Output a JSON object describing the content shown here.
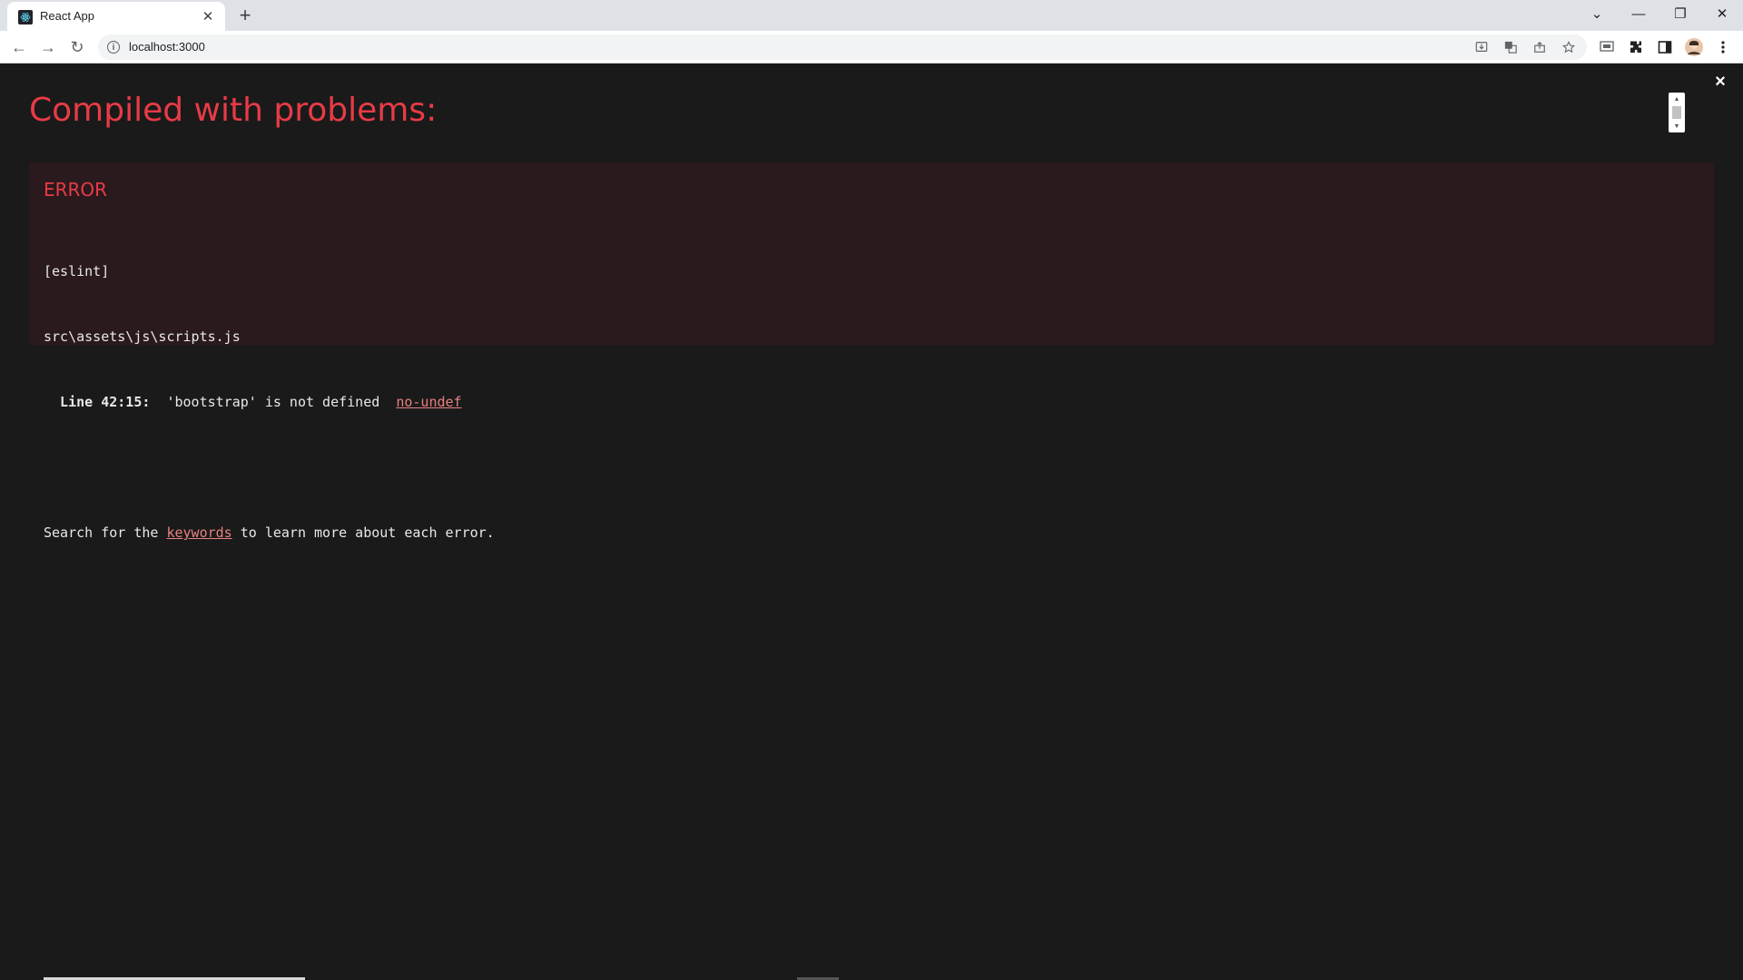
{
  "browser": {
    "tab": {
      "title": "React App",
      "close_glyph": "✕"
    },
    "new_tab_glyph": "+",
    "window_controls": {
      "tab_search": "⌄",
      "minimize": "—",
      "restore": "❐",
      "close": "✕"
    },
    "nav": {
      "back": "←",
      "forward": "→",
      "reload": "↻"
    },
    "url": "localhost:3000",
    "info_glyph": "i",
    "omnibox_icons": [
      "install-icon",
      "translate-icon",
      "share-icon",
      "bookmark-star-icon"
    ],
    "toolbar_icons": [
      "media-router-icon",
      "extensions-icon",
      "side-panel-icon",
      "profile-avatar-icon",
      "menu-icon"
    ]
  },
  "overlay": {
    "title": "Compiled with problems:",
    "close_glyph": "×",
    "error": {
      "header": "ERROR",
      "source": "[eslint]",
      "file": "src\\assets\\js\\scripts.js",
      "line_prefix": "  Line 42:15:",
      "message": "  'bootstrap' is not defined  ",
      "rule": "no-undef",
      "search_prefix": "Search for the ",
      "keywords_link": "keywords",
      "search_suffix": " to learn more about each error."
    }
  },
  "colors": {
    "accent_red": "#e83b46",
    "overlay_bg": "#1a1a1a",
    "error_box_bg": "#2a1a1d",
    "link_red": "#e88080"
  }
}
